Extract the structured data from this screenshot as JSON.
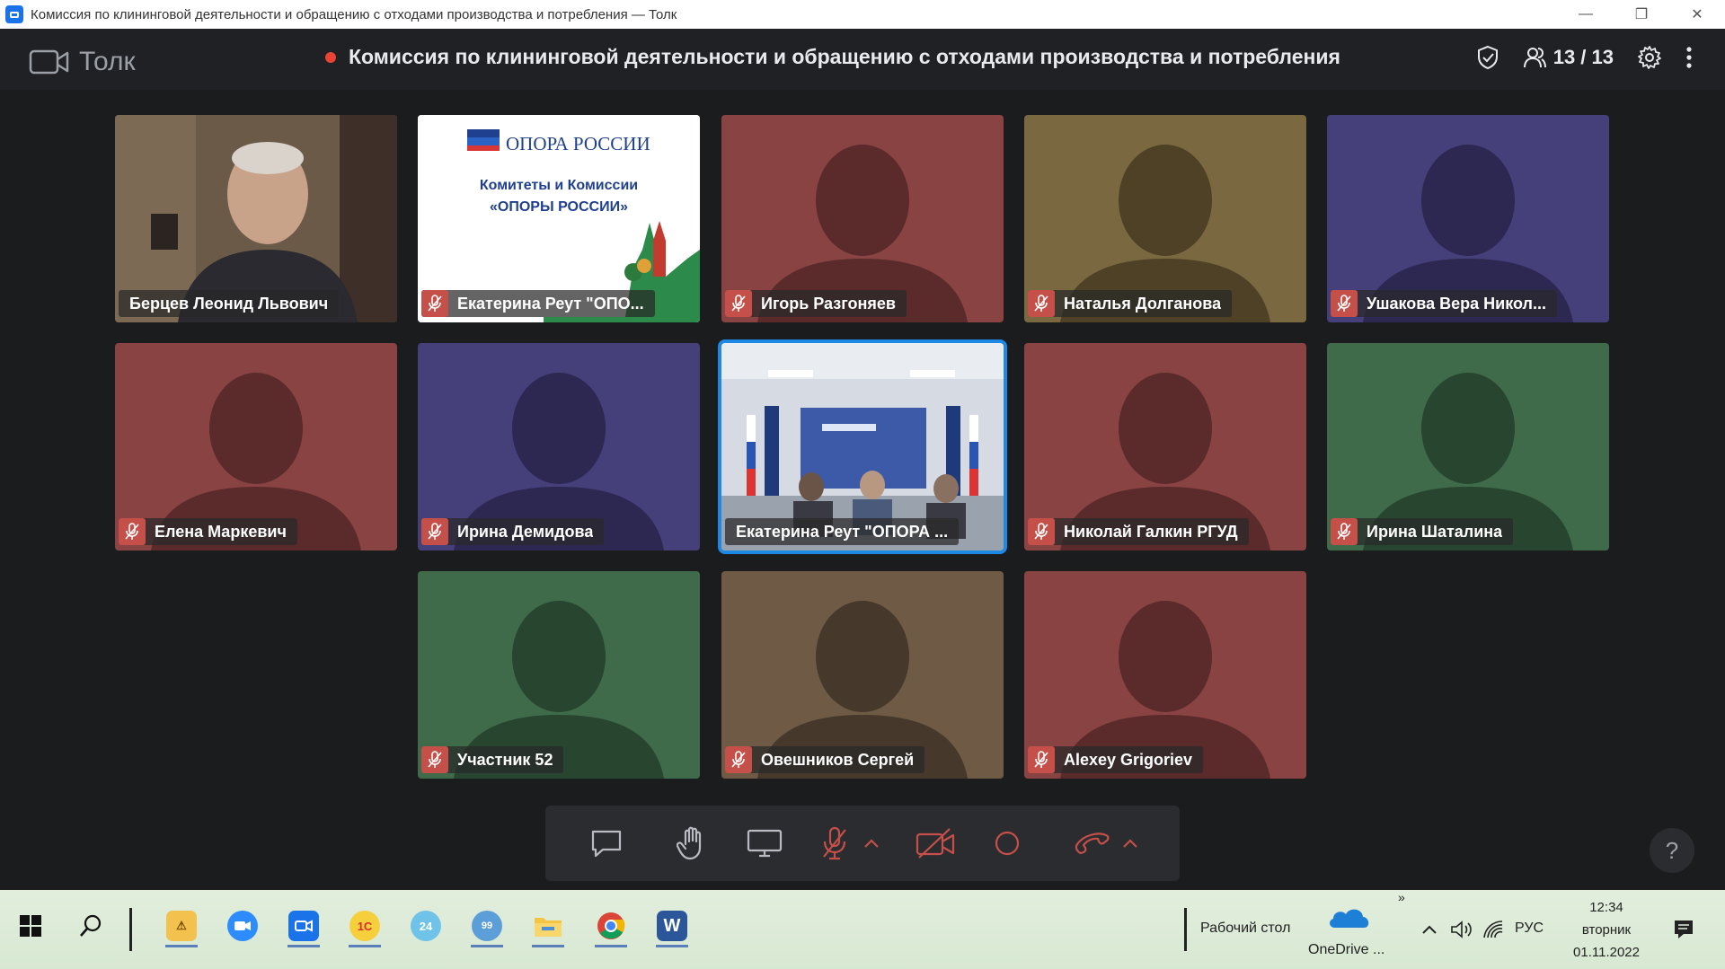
{
  "window": {
    "title": "Комиссия по клининговой деятельности и обращению с отходами производства и потребления — Толк",
    "minimize": "—",
    "restore": "❐",
    "close": "✕"
  },
  "header": {
    "brand": "Толк",
    "meeting_title": "Комиссия по клининговой деятельности и обращению с отходами производства и потребления",
    "participants_count": "13 / 13"
  },
  "colors": {
    "red_tile": "#8a4343",
    "olive_tile": "#7a6840",
    "purple_tile": "#453f7a",
    "green_tile": "#3f6b4a",
    "brown_tile": "#6e5a45",
    "accent": "#1e88e5",
    "muted": "#c5504a"
  },
  "tiles": [
    {
      "name": "Берцев Леонид Львович",
      "type": "video",
      "muted": false
    },
    {
      "name": "Екатерина Реут \"ОПО...",
      "type": "slide",
      "muted": true
    },
    {
      "name": "Игорь Разгоняев",
      "type": "avatar",
      "color": "red",
      "muted": true
    },
    {
      "name": "Наталья Долганова",
      "type": "avatar",
      "color": "olive",
      "muted": true
    },
    {
      "name": "Ушакова Вера Никол...",
      "type": "avatar",
      "color": "purple",
      "muted": true
    },
    {
      "name": "Елена Маркевич",
      "type": "avatar",
      "color": "red",
      "muted": true
    },
    {
      "name": "Ирина Демидова",
      "type": "avatar",
      "color": "purple",
      "muted": true
    },
    {
      "name": "Екатерина Реут \"ОПОРА ...",
      "type": "room",
      "muted": false,
      "selected": true
    },
    {
      "name": "Николай Галкин РГУД",
      "type": "avatar",
      "color": "red",
      "muted": true
    },
    {
      "name": "Ирина Шаталина",
      "type": "avatar",
      "color": "green",
      "muted": true
    },
    {
      "name": "Участник 52",
      "type": "avatar",
      "color": "green",
      "muted": true
    },
    {
      "name": "Овешников Сергей",
      "type": "avatar",
      "color": "brown",
      "muted": true
    },
    {
      "name": "Alexey Grigoriev",
      "type": "avatar",
      "color": "red",
      "muted": true
    }
  ],
  "slide": {
    "logo_text": "ОПОРА РОССИИ",
    "line1": "Комитеты и Комиссии",
    "line2": "«ОПОРЫ РОССИИ»"
  },
  "help": "?",
  "taskbar": {
    "desktop_label": "Рабочий стол",
    "onedrive_label": "OneDrive ...",
    "lang": "РУС",
    "time": "12:34",
    "weekday": "вторник",
    "date": "01.11.2022",
    "chevron": "»",
    "app_1c": "1С",
    "app_24": "24",
    "app_99": "99",
    "app_word": "W"
  }
}
